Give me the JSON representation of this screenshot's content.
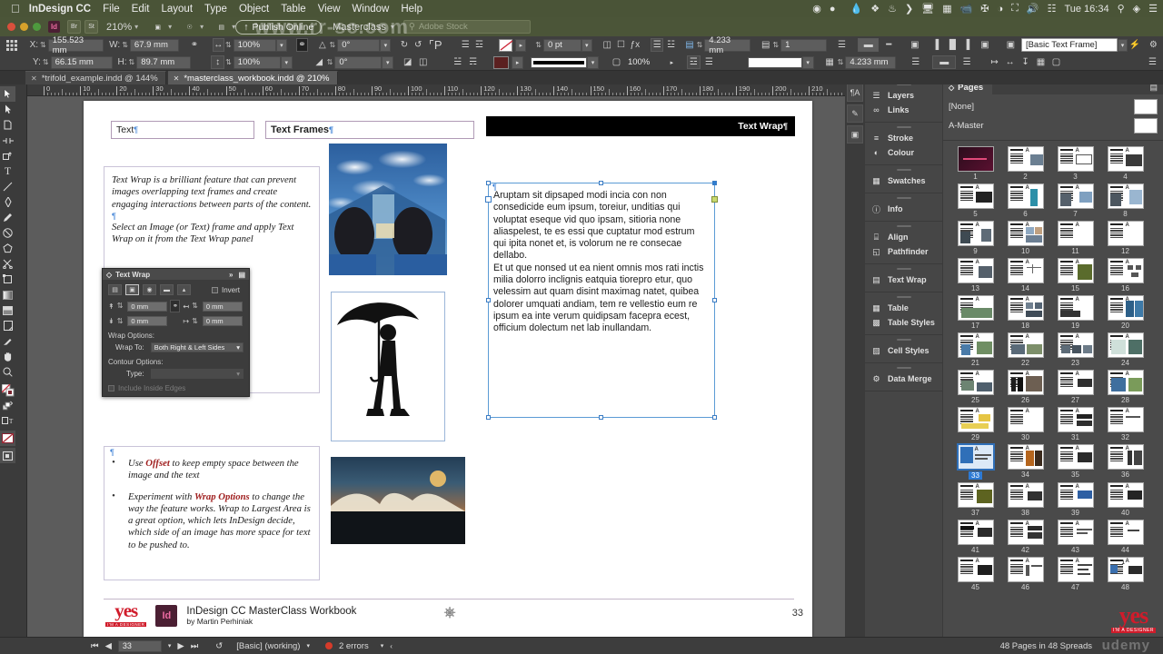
{
  "macmenu": {
    "apple": "apple-logo",
    "app": "InDesign CC",
    "items": [
      "File",
      "Edit",
      "Layout",
      "Type",
      "Object",
      "Table",
      "View",
      "Window",
      "Help"
    ],
    "clock": "Tue 16:34"
  },
  "approw": {
    "zoom": "210%",
    "publish": "Publish Online",
    "workspace": "Masterclass",
    "stock_placeholder": "Adobe Stock",
    "watermark": "www.rr-sc.com"
  },
  "control": {
    "x_label": "X:",
    "x_value": "155.523 mm",
    "y_label": "Y:",
    "y_value": "66.15 mm",
    "w_label": "W:",
    "w_value": "67.9 mm",
    "h_label": "H:",
    "h_value": "89.7 mm",
    "scale_x": "100%",
    "scale_y": "100%",
    "rotate": "0°",
    "shear": "0°",
    "stroke_weight": "0 pt",
    "opacity": "100%",
    "col_gutter_a": "4.233 mm",
    "col_count": "1",
    "col_gutter_b": "4.233 mm",
    "object_style": "[Basic Text Frame]"
  },
  "tabs": [
    {
      "label": "*trifold_example.indd @ 144%",
      "active": false
    },
    {
      "label": "*masterclass_workbook.indd @ 210%",
      "active": true
    }
  ],
  "ruler": {
    "h_numbers": [
      "0",
      "10",
      "20",
      "30",
      "40",
      "50",
      "60",
      "70",
      "80",
      "90",
      "100",
      "110",
      "120",
      "130",
      "140",
      "150",
      "160",
      "170",
      "180",
      "190",
      "200",
      "210"
    ]
  },
  "tools": [
    "selection-tool",
    "direct-selection-tool",
    "page-tool",
    "gap-tool",
    "content-collector-tool",
    "type-tool",
    "line-tool",
    "pen-tool",
    "pencil-tool",
    "rectangle-frame-tool",
    "polygon-tool",
    "scissors-tool",
    "free-transform-tool",
    "gradient-swatch-tool",
    "gradient-feather-tool",
    "note-tool",
    "eyedropper-tool",
    "hand-tool",
    "zoom-tool"
  ],
  "document": {
    "header_left": "Text",
    "header_mid": "Text Frames",
    "header_right": "Text Wrap",
    "intro_para_1": "Text Wrap is a brilliant feature that can prevent images overlapping text frames and create engaging interactions between parts of the content.",
    "intro_para_2": "Select an Image (or Text) frame and apply Text Wrap on it from the Text Wrap panel",
    "bullets": [
      {
        "pre": "Use ",
        "bold": "Offset",
        "post": " to keep empty space between the image and the text"
      },
      {
        "pre": "Experiment with ",
        "bold": "Wrap Options",
        "post": " to change the way the feature works. Wrap to Largest Area is a great option, which lets InDesign decide, which side of an image has more space for text to be pushed to."
      }
    ],
    "latin_para_1": "Aruptam sit dipsaped modi incia con non consedicide eum ipsum, toreiur, unditias qui voluptat eseque vid quo ipsam, sitioria none aliaspelest, te es essi que cuptatur mod estrum qui ipita nonet et, is volorum ne re consecae dellabo.",
    "latin_para_2": "Et ut que nonsed ut ea nient omnis mos rati inctis milia dolorro inclignis eatquia tiorepro etur, quo velessim aut quam disint maximag natet, quibea dolorer umquati andiam, tem re vellestio eum re ipsum ea inte verum quidipsam facepra ecest, officium dolectum net lab inullandam.",
    "footer_title": "InDesign CC MasterClass Workbook",
    "footer_sub": "by Martin Perhiniak",
    "footer_logo": "yes",
    "footer_logo_sub": "I'M A DESIGNER",
    "footer_app_badge": "Id",
    "page_number": "33"
  },
  "textwrap_panel": {
    "title": "Text Wrap",
    "invert_label": "Invert",
    "buttons": [
      "no-text-wrap",
      "wrap-around-bounding-box",
      "wrap-around-object-shape",
      "jump-object",
      "jump-to-next-column"
    ],
    "offsets": {
      "top": "0 mm",
      "bottom": "0 mm",
      "left": "0 mm",
      "right": "0 mm"
    },
    "wrap_options_label": "Wrap Options:",
    "wrap_to_label": "Wrap To:",
    "wrap_to_value": "Both Right & Left Sides",
    "contour_options_label": "Contour Options:",
    "type_label": "Type:",
    "type_value": "",
    "include_inside_edges": "Include Inside Edges"
  },
  "panels": [
    {
      "items": [
        {
          "label": "Layers",
          "icon": "layers-icon"
        },
        {
          "label": "Links",
          "icon": "links-icon"
        }
      ]
    },
    {
      "items": [
        {
          "label": "Stroke",
          "icon": "stroke-icon"
        },
        {
          "label": "Colour",
          "icon": "colour-icon"
        }
      ]
    },
    {
      "items": [
        {
          "label": "Swatches",
          "icon": "swatches-icon"
        }
      ]
    },
    {
      "items": [
        {
          "label": "Info",
          "icon": "info-icon"
        }
      ]
    },
    {
      "items": [
        {
          "label": "Align",
          "icon": "align-icon"
        },
        {
          "label": "Pathfinder",
          "icon": "pathfinder-icon"
        }
      ]
    },
    {
      "items": [
        {
          "label": "Text Wrap",
          "icon": "textwrap-icon"
        }
      ]
    },
    {
      "items": [
        {
          "label": "Table",
          "icon": "table-icon"
        },
        {
          "label": "Table Styles",
          "icon": "table-styles-icon"
        }
      ]
    },
    {
      "items": [
        {
          "label": "Cell Styles",
          "icon": "cell-styles-icon"
        }
      ]
    },
    {
      "items": [
        {
          "label": "Data Merge",
          "icon": "data-merge-icon"
        }
      ]
    }
  ],
  "pages_panel": {
    "tab_label": "Pages",
    "master_none": "[None]",
    "master_a": "A-Master",
    "selected_page": "33",
    "page_numbers": [
      "1",
      "2",
      "3",
      "4",
      "5",
      "6",
      "7",
      "8",
      "9",
      "10",
      "11",
      "12",
      "13",
      "14",
      "15",
      "16",
      "17",
      "18",
      "19",
      "20",
      "21",
      "22",
      "23",
      "24",
      "25",
      "26",
      "27",
      "28",
      "29",
      "30",
      "31",
      "32",
      "33",
      "34",
      "35",
      "36",
      "37",
      "38",
      "39",
      "40",
      "41",
      "42",
      "43",
      "44",
      "45",
      "46",
      "47",
      "48"
    ]
  },
  "status": {
    "page": "33",
    "preflight_profile": "[Basic] (working)",
    "errors": "2 errors",
    "spread_info": "48 Pages in 48 Spreads",
    "watermark": "udemy"
  },
  "colors": {
    "menu_green": "#4a5437",
    "accent_blue": "#2d7ad4",
    "error_red": "#d63b2a",
    "brand_red": "#d01c2b",
    "panel_bg": "#464646",
    "canvas_bg": "#5c5c5c"
  }
}
